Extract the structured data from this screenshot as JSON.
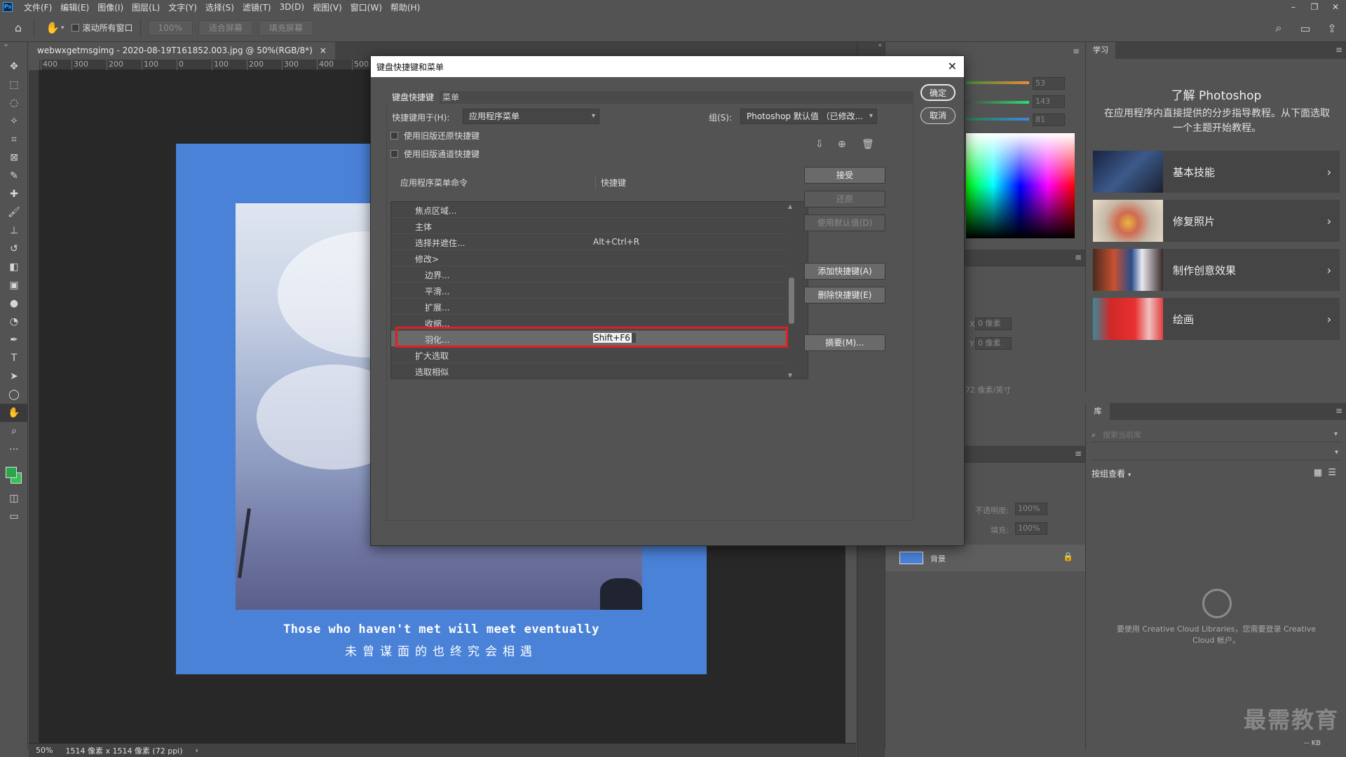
{
  "menubar": {
    "logo": "Ps",
    "items": [
      "文件(F)",
      "编辑(E)",
      "图像(I)",
      "图层(L)",
      "文字(Y)",
      "选择(S)",
      "滤镜(T)",
      "3D(D)",
      "视图(V)",
      "窗口(W)",
      "帮助(H)"
    ],
    "win_minimize": "–",
    "win_restore": "❐",
    "win_close": "✕"
  },
  "options": {
    "scroll_all_label": "滚动所有窗口",
    "zoom_btn": "100%",
    "fit_btn": "适合屏幕",
    "fill_btn": "填充屏幕"
  },
  "document": {
    "tab_title": "webwxgetmsgimg - 2020-08-19T161852.003.jpg @ 50%(RGB/8*)",
    "tab_close": "×",
    "ruler_ticks": [
      "400",
      "300",
      "200",
      "100",
      "0",
      "100",
      "200",
      "300",
      "400",
      "500"
    ],
    "caption_en": "Those who haven't met will meet eventually",
    "caption_cn": "未曾谋面的也终究会相遇"
  },
  "status": {
    "zoom": "50%",
    "info": "1514 像素 x 1514 像素 (72 ppi)",
    "arrow": "›"
  },
  "color_panel": {
    "values": [
      "53",
      "143",
      "81"
    ]
  },
  "props_panel": {
    "x_label": "X",
    "y_label": "Y",
    "x_value": "0 像素",
    "y_value": "0 像素",
    "resolution": "72 像素/英寸"
  },
  "layers_panel": {
    "opacity_label": "不透明度:",
    "opacity_value": "100%",
    "fill_label": "填充:",
    "fill_value": "100%",
    "layer_name": "背景"
  },
  "learn": {
    "tab": "学习",
    "title": "了解 Photoshop",
    "desc": "在应用程序内直接提供的分步指导教程。从下面选取一个主题开始教程。",
    "cards": [
      {
        "label": "基本技能"
      },
      {
        "label": "修复照片"
      },
      {
        "label": "制作创意效果"
      },
      {
        "label": "绘画"
      }
    ]
  },
  "library": {
    "tab": "库",
    "search_placeholder": "搜索当前库",
    "group_by": "按组查看",
    "message": "要使用 Creative Cloud Libraries，您需要登录 Creative Cloud 帐户。",
    "size": "-- KB"
  },
  "watermark": "最需教育",
  "dialog": {
    "title": "键盘快捷键和菜单",
    "tabs": [
      "键盘快捷键",
      "菜单"
    ],
    "shortcuts_for_label": "快捷键用于(H):",
    "shortcuts_for_value": "应用程序菜单",
    "set_label": "组(S):",
    "set_value": "Photoshop 默认值 （已修改...",
    "legacy_undo": "使用旧版还原快捷键",
    "legacy_channel": "使用旧版通道快捷键",
    "col_command": "应用程序菜单命令",
    "col_shortcut": "快捷键",
    "rows": [
      {
        "cmd": "焦点区域...",
        "key": ""
      },
      {
        "cmd": "主体",
        "key": ""
      },
      {
        "cmd": "选择并遮住...",
        "key": "Alt+Ctrl+R"
      },
      {
        "cmd": "修改>",
        "key": ""
      },
      {
        "cmd": "边界...",
        "key": ""
      },
      {
        "cmd": "平滑...",
        "key": ""
      },
      {
        "cmd": "扩展...",
        "key": ""
      },
      {
        "cmd": "收缩...",
        "key": ""
      },
      {
        "cmd": "羽化...",
        "key": "Shift+F6"
      },
      {
        "cmd": "扩大选取",
        "key": ""
      },
      {
        "cmd": "选取相似",
        "key": ""
      }
    ],
    "btn_ok": "确定",
    "btn_cancel": "取消",
    "btn_accept": "接受",
    "btn_undo": "还原",
    "btn_default": "使用默认值(D)",
    "btn_add": "添加快捷键(A)",
    "btn_delete": "删除快捷键(E)",
    "btn_summary": "摘要(M)..."
  }
}
